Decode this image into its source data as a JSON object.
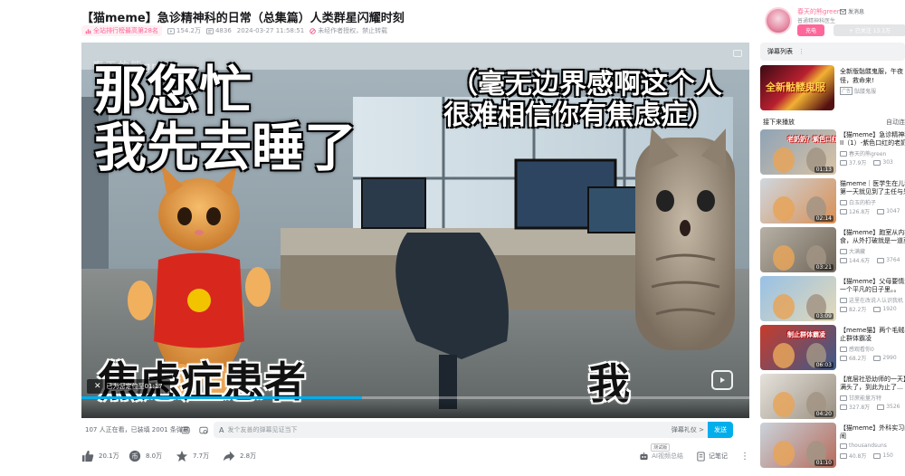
{
  "video": {
    "title": "【猫meme】急诊精神科的日常（总集篇）人类群星闪耀时刻",
    "rank_badge": "全站排行榜最高第28名",
    "views": "154.2万",
    "danmaku_count": "4836",
    "date": "2024-03-27 11:58:51",
    "copyright_note": "未经作者授权，禁止转载"
  },
  "player": {
    "watermark": "春天的熊green",
    "caption_top_left_line1": "那您忙",
    "caption_top_left_line2": "我先去睡了",
    "caption_top_right_line1": "（毫无边界感啊这个人",
    "caption_top_right_line2": "很难相信你有焦虑症）",
    "caption_bottom_left": "焦虑症患者",
    "caption_bottom_right": "我",
    "toast_text": "已为您定位至01:17",
    "progress_fraction": 0.42
  },
  "danmaku_bar": {
    "online": "107 人正在看，已装填 2001 条弹幕",
    "placeholder": "发个友善的弹幕见证当下",
    "etiquette": "弹幕礼仪 >",
    "send_label": "发送"
  },
  "actions": {
    "like": "20.1万",
    "coin": "8.0万",
    "favorite": "7.7万",
    "share": "2.8万",
    "ai_label": "AI视频总结",
    "ai_tag": "测试版",
    "notes_label": "记笔记"
  },
  "uploader": {
    "name": "春天的熊green",
    "desc": "普通精神科医生",
    "message_label": "发消息",
    "charge_label": "充电",
    "follow_label": "+ 已关注 13.1万"
  },
  "danmaku_list_label": "弹幕列表",
  "ad": {
    "thumb_text": "全新骷髅鬼服",
    "title_line1": "全新版骷髅鬼服，午夜",
    "title_line2": "怪，救命来!",
    "source_tag": "广告",
    "source": "骷髅鬼服"
  },
  "next": {
    "heading": "接下来播放",
    "autoplay": "自动连"
  },
  "recommendations": [
    {
      "title1": "【猫meme】急诊精神科",
      "title2": "II（1）-紫色口红的老奶",
      "uploader": "春天的熊green",
      "views": "37.9万",
      "danmaku": "303",
      "duration": "01:13",
      "thumb_text": "老奶奶？紫色口红？",
      "color1": "#8fa3b6",
      "color2": "#d9c3a5"
    },
    {
      "title1": "猫meme｜医学生在儿科",
      "title2": "第一天就见到了主任与患",
      "uploader": "白玉的柏子",
      "views": "126.8万",
      "danmaku": "1047",
      "duration": "02:14",
      "thumb_text": "",
      "color1": "#cfd7df",
      "color2": "#d88f54"
    },
    {
      "title1": "【猫meme】跑室从内打",
      "title2": "食，从外打破就是一道菜",
      "uploader": "大满藏",
      "views": "144.6万",
      "danmaku": "3764",
      "duration": "03:21",
      "thumb_text": "",
      "color1": "#b7b0a5",
      "color2": "#6f6658"
    },
    {
      "title1": "【猫meme】父母要情生",
      "title2": "一个平凡的日子里。。",
      "uploader": "这里在改说人认识我机",
      "views": "82.2万",
      "danmaku": "1920",
      "duration": "03:09",
      "thumb_text": "",
      "color1": "#97c1e6",
      "color2": "#e4d9b8"
    },
    {
      "title1": "【meme猫】两个毛贼小",
      "title2": "止群体霸凌",
      "uploader": "感观看你0",
      "views": "68.2万",
      "danmaku": "2990",
      "duration": "06:03",
      "thumb_text": "制止群体霸凌",
      "color1": "#c73b2c",
      "color2": "#3a5b8c"
    },
    {
      "title1": "【底层社恐幼师的一天】",
      "title2": "满头了，到此为止了…",
      "uploader": "甘蔗能量万特",
      "views": "327.8万",
      "danmaku": "3526",
      "duration": "04:20",
      "thumb_text": "",
      "color1": "#e5e2dc",
      "color2": "#9a8f80"
    },
    {
      "title1": "【猫meme】外科实习的",
      "title2": "闹",
      "uploader": "thousandsuns",
      "views": "40.8万",
      "danmaku": "150",
      "duration": "01:10",
      "thumb_text": "",
      "color1": "#c9d3db",
      "color2": "#b66b5b"
    }
  ]
}
